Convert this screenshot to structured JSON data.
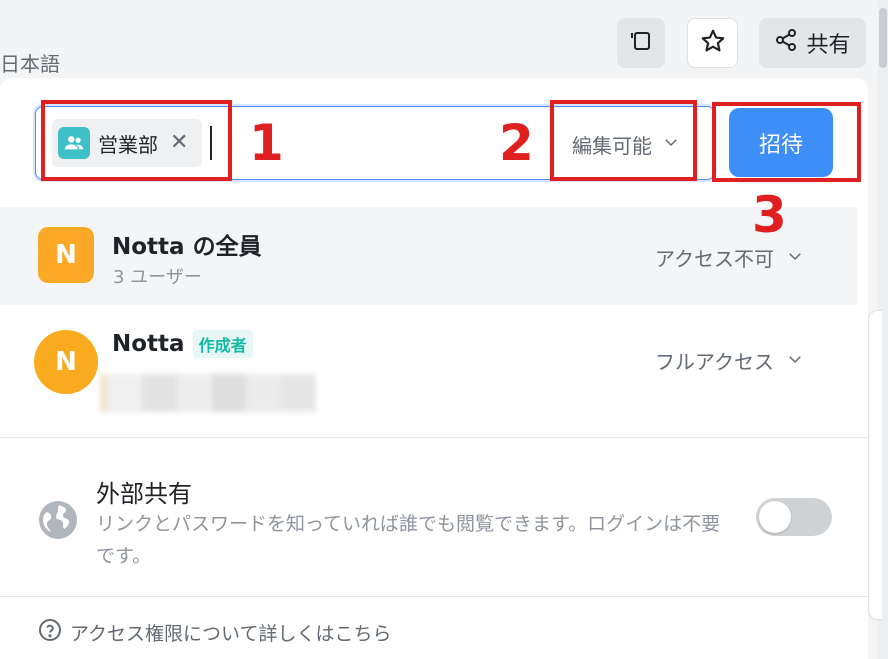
{
  "header": {
    "language": "日本語",
    "share_label": "共有"
  },
  "invite": {
    "chip_label": "営業部",
    "chip_close": "✕",
    "permission": "編集可能",
    "invite_button": "招待"
  },
  "annotations": {
    "one": "1",
    "two": "2",
    "three": "3"
  },
  "members": [
    {
      "avatar": "N",
      "name": "Notta の全員",
      "subtitle": "3 ユーザー",
      "access": "アクセス不可"
    },
    {
      "avatar": "N",
      "name": "Notta",
      "badge": "作成者",
      "access": "フルアクセス"
    }
  ],
  "external_share": {
    "title": "外部共有",
    "description": "リンクとパスワードを知っていれば誰でも閲覧できます。ログインは不要です。",
    "enabled": false
  },
  "help": {
    "link_text": "アクセス権限について詳しくはこちら"
  },
  "colors": {
    "accent": "#3e8ef7",
    "annotation": "#e02020",
    "avatar": "#fba926",
    "chip_icon": "#3fbfc6",
    "badge": "#14b8a6"
  }
}
